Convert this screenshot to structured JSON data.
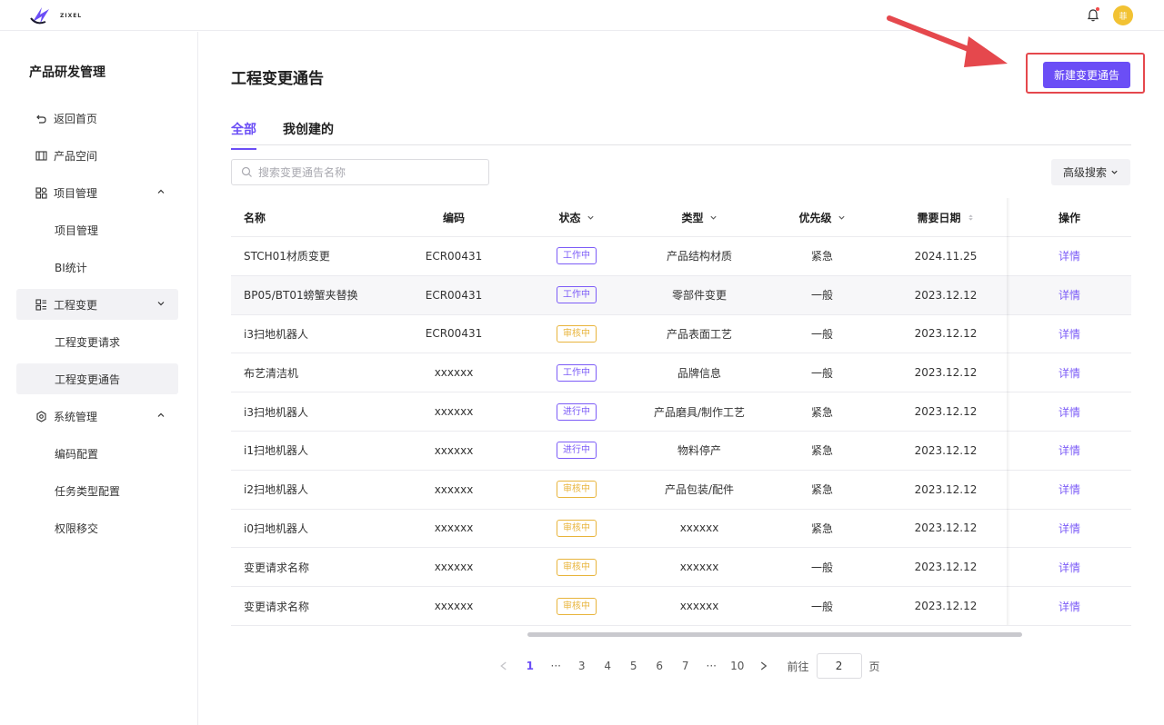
{
  "topbar": {
    "logo_text": "ZIXEL",
    "avatar_text": "菲"
  },
  "sidebar": {
    "title": "产品研发管理",
    "items": [
      {
        "label": "返回首页"
      },
      {
        "label": "产品空间"
      },
      {
        "label": "项目管理"
      },
      {
        "label": "项目管理"
      },
      {
        "label": "BI统计"
      },
      {
        "label": "工程变更"
      },
      {
        "label": "工程变更请求"
      },
      {
        "label": "工程变更通告"
      },
      {
        "label": "系统管理"
      },
      {
        "label": "编码配置"
      },
      {
        "label": "任务类型配置"
      },
      {
        "label": "权限移交"
      }
    ]
  },
  "main": {
    "title": "工程变更通告",
    "new_button": "新建变更通告",
    "tabs": [
      {
        "label": "全部"
      },
      {
        "label": "我创建的"
      }
    ],
    "search_placeholder": "搜索变更通告名称",
    "advanced_search": "高级搜索"
  },
  "table": {
    "headers": {
      "name": "名称",
      "code": "编码",
      "status": "状态",
      "type": "类型",
      "priority": "优先级",
      "date": "需要日期",
      "op": "操作"
    },
    "rows": [
      {
        "name": "STCH01材质变更",
        "code": "ECR00431",
        "status": "工作中",
        "type": "产品结构材质",
        "priority": "紧急",
        "date": "2024.11.25",
        "op": "详情"
      },
      {
        "name": "BP05/BT01螃蟹夹替换",
        "code": "ECR00431",
        "status": "工作中",
        "type": "零部件变更",
        "priority": "一般",
        "date": "2023.12.12",
        "op": "详情"
      },
      {
        "name": "i3扫地机器人",
        "code": "ECR00431",
        "status": "审核中",
        "type": "产品表面工艺",
        "priority": "一般",
        "date": "2023.12.12",
        "op": "详情"
      },
      {
        "name": "布艺清洁机",
        "code": "xxxxxx",
        "status": "工作中",
        "type": "品牌信息",
        "priority": "一般",
        "date": "2023.12.12",
        "op": "详情"
      },
      {
        "name": "i3扫地机器人",
        "code": "xxxxxx",
        "status": "进行中",
        "type": "产品磨具/制作工艺",
        "priority": "紧急",
        "date": "2023.12.12",
        "op": "详情"
      },
      {
        "name": "i1扫地机器人",
        "code": "xxxxxx",
        "status": "进行中",
        "type": "物料停产",
        "priority": "紧急",
        "date": "2023.12.12",
        "op": "详情"
      },
      {
        "name": "i2扫地机器人",
        "code": "xxxxxx",
        "status": "审核中",
        "type": "产品包装/配件",
        "priority": "紧急",
        "date": "2023.12.12",
        "op": "详情"
      },
      {
        "name": "i0扫地机器人",
        "code": "xxxxxx",
        "status": "审核中",
        "type": "xxxxxx",
        "priority": "紧急",
        "date": "2023.12.12",
        "op": "详情"
      },
      {
        "name": "变更请求名称",
        "code": "xxxxxx",
        "status": "审核中",
        "type": "xxxxxx",
        "priority": "一般",
        "date": "2023.12.12",
        "op": "详情"
      },
      {
        "name": "变更请求名称",
        "code": "xxxxxx",
        "status": "审核中",
        "type": "xxxxxx",
        "priority": "一般",
        "date": "2023.12.12",
        "op": "详情"
      }
    ]
  },
  "pagination": {
    "pages": [
      "1",
      "···",
      "3",
      "4",
      "5",
      "6",
      "7",
      "···",
      "10"
    ],
    "current": "1",
    "goto_label": "前往",
    "goto_value": "2",
    "page_suffix": "页"
  },
  "colors": {
    "accent": "#6b4ef6",
    "review": "#e8b43c",
    "highlight_box": "#e5484d"
  }
}
